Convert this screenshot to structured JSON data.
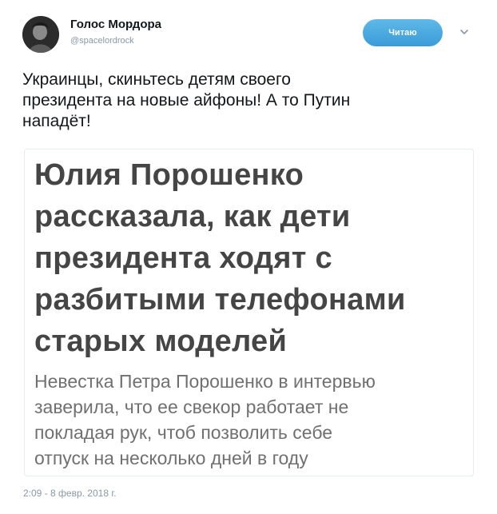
{
  "header": {
    "display_name": "Голос Мордора",
    "handle": "@spacelordrock",
    "follow_label": "Читаю"
  },
  "tweet": {
    "text": "Украинцы, скиньтесь детям своего\nпрезидента на новые айфоны! А то Путин\nнападёт!",
    "timestamp": "2:09 - 8 февр. 2018 г."
  },
  "media": {
    "headline": "Юлия Порошенко\nрассказала, как дети\nпрезидента ходят с\nразбитыми телефонами\nстарых моделей",
    "lead": "Невестка Петра Порошенко в интервью\nзаверила, что ее свекор работает не\nпокладая рук, чтоб позволить себе\nотпуск на несколько дней в году"
  },
  "colors": {
    "accent": "#1da1f2",
    "text_primary": "#14171a",
    "text_secondary": "#8899a6"
  },
  "icons": {
    "avatar": "user-avatar",
    "caret": "chevron-down-icon"
  }
}
